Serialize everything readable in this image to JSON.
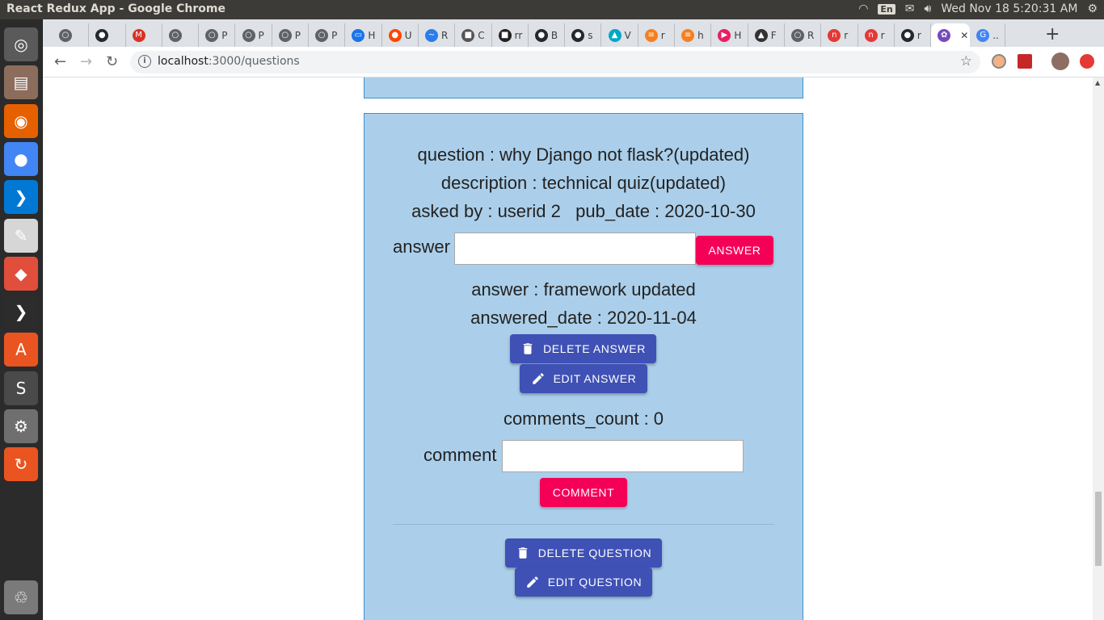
{
  "window": {
    "title": "React Redux App - Google Chrome"
  },
  "system_tray": {
    "keyboard": "En",
    "clock": "Wed Nov 18  5:20:31 AM"
  },
  "launcher": {
    "items": [
      {
        "icon": "ubuntu-dash-icon",
        "color": "#5a5a5a"
      },
      {
        "icon": "files-icon",
        "color": "#8c6d5c"
      },
      {
        "icon": "firefox-icon",
        "color": "#e66000"
      },
      {
        "icon": "chrome-icon",
        "color": "#4285f4"
      },
      {
        "icon": "vscode-icon",
        "color": "#0078d4"
      },
      {
        "icon": "text-editor-icon",
        "color": "#d6d6d6"
      },
      {
        "icon": "git-icon",
        "color": "#e14e3b"
      },
      {
        "icon": "terminal-icon",
        "color": "#2c2c2c"
      },
      {
        "icon": "software-center-icon",
        "color": "#e95420"
      },
      {
        "icon": "sublime-icon",
        "color": "#4a4a4a"
      },
      {
        "icon": "settings-icon",
        "color": "#6f6f6f"
      },
      {
        "icon": "updater-icon",
        "color": "#e95420"
      },
      {
        "icon": "trash-icon",
        "color": "#7a7a7a"
      }
    ]
  },
  "tabs": [
    {
      "label": "",
      "icon": "globe-icon",
      "color": "#5f6368"
    },
    {
      "label": "",
      "icon": "github-icon",
      "color": "#24292e"
    },
    {
      "label": "",
      "icon": "gmail-icon",
      "color": "#d93025"
    },
    {
      "label": "",
      "icon": "globe-icon",
      "color": "#5f6368"
    },
    {
      "label": "P",
      "icon": "globe-icon",
      "color": "#5f6368"
    },
    {
      "label": "P",
      "icon": "globe-icon",
      "color": "#5f6368"
    },
    {
      "label": "P",
      "icon": "globe-icon",
      "color": "#5f6368"
    },
    {
      "label": "P",
      "icon": "globe-icon",
      "color": "#5f6368"
    },
    {
      "label": "H",
      "icon": "monitor-icon",
      "color": "#1a73e8"
    },
    {
      "label": "U",
      "icon": "reddit-icon",
      "color": "#ff4500"
    },
    {
      "label": "R",
      "icon": "wave-icon",
      "color": "#2b7de9"
    },
    {
      "label": "C",
      "icon": "box-icon",
      "color": "#555555"
    },
    {
      "label": "rr",
      "icon": "media-icon",
      "color": "#222222"
    },
    {
      "label": "B",
      "icon": "github-icon",
      "color": "#24292e"
    },
    {
      "label": "s",
      "icon": "github-icon",
      "color": "#24292e"
    },
    {
      "label": "V",
      "icon": "bird-icon",
      "color": "#00a8c6"
    },
    {
      "label": "r",
      "icon": "stackoverflow-icon",
      "color": "#f48024"
    },
    {
      "label": "h",
      "icon": "stackoverflow-icon",
      "color": "#f48024"
    },
    {
      "label": "H",
      "icon": "play-icon",
      "color": "#e91e63"
    },
    {
      "label": "F",
      "icon": "linux-icon",
      "color": "#333333"
    },
    {
      "label": "R",
      "icon": "globe-icon",
      "color": "#5f6368"
    },
    {
      "label": "r",
      "icon": "n-icon",
      "color": "#e53935"
    },
    {
      "label": "r",
      "icon": "n-icon",
      "color": "#e53935"
    },
    {
      "label": "r",
      "icon": "github-icon",
      "color": "#24292e"
    },
    {
      "label": "",
      "icon": "redux-icon",
      "color": "#764abc",
      "active": true
    },
    {
      "label": "..",
      "icon": "google-icon",
      "color": "#4285f4"
    }
  ],
  "address_bar": {
    "host": "localhost",
    "path": ":3000/questions"
  },
  "question": {
    "title_line": "question : why Django not flask?(updated)",
    "description_line": "description : technical quiz(updated)",
    "meta_line": "asked by : userid 2   pub_date : 2020-10-30",
    "answer_label": "answer",
    "answer_input_value": "",
    "answer_button": "ANSWER",
    "answers": [
      {
        "answer_line": "answer : framework updated",
        "date_line": "answered_date : 2020-11-04",
        "delete_button": "DELETE ANSWER",
        "edit_button": "EDIT ANSWER"
      }
    ],
    "comments_count_line": "comments_count : 0",
    "comment_label": "comment",
    "comment_input_value": "",
    "comment_button": "COMMENT",
    "delete_question_button": "DELETE QUESTION",
    "edit_question_button": "EDIT QUESTION"
  },
  "colors": {
    "card_bg": "#abcfea",
    "card_border": "#3d8fd1",
    "primary": "#3f51b5",
    "secondary": "#f50057"
  }
}
